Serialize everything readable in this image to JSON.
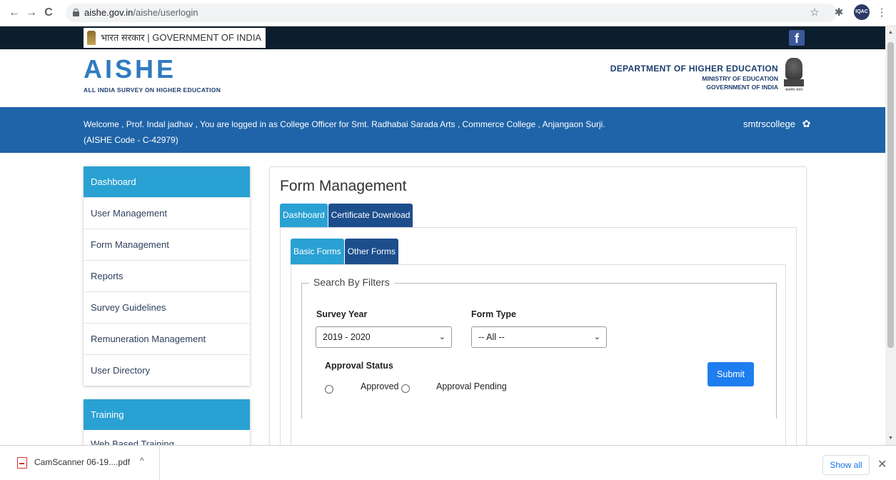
{
  "browser": {
    "url_host": "aishe.gov.in",
    "url_path": "/aishe/userlogin",
    "back_icon": "←",
    "forward_icon": "→",
    "reload_icon": "C",
    "star_icon": "☆",
    "puzzle_icon": "✱",
    "ext_badge": "IQAC",
    "menu_icon": "⋮"
  },
  "gov_strip": {
    "label": "भारत सरकार | GOVERNMENT OF INDIA",
    "facebook": "f"
  },
  "header": {
    "logo": "AISHE",
    "logo_sub": "ALL INDIA SURVEY ON HIGHER EDUCATION",
    "dept_line1": "DEPARTMENT OF HIGHER EDUCATION",
    "dept_line2": "MINISTRY OF EDUCATION",
    "dept_line3": "GOVERNMENT OF INDIA",
    "emblem_text": "सत्यमेव जयते"
  },
  "welcome": {
    "line1": "Welcome , Prof. Indal jadhav , You are logged in as College Officer for Smt. Radhabai Sarada Arts , Commerce College , Anjangaon Surji.",
    "line2": "(AISHE Code - C-42979)",
    "username": "smtrscollege",
    "gear": "✿"
  },
  "sidebar": {
    "heading": "Dashboard",
    "items": [
      {
        "label": "User Management"
      },
      {
        "label": "Form Management"
      },
      {
        "label": "Reports"
      },
      {
        "label": "Survey Guidelines"
      },
      {
        "label": "Remuneration Management"
      },
      {
        "label": "User Directory"
      }
    ]
  },
  "training": {
    "heading": "Training",
    "items": [
      {
        "label": "Web Based Training"
      }
    ]
  },
  "main": {
    "title": "Form Management",
    "tabs": [
      {
        "label": "Dashboard",
        "active": true
      },
      {
        "label": "Certificate Download",
        "active": false
      }
    ],
    "subtabs": [
      {
        "label": "Basic Forms",
        "active": true
      },
      {
        "label": "Other Forms",
        "active": false
      }
    ],
    "filters": {
      "legend": "Search By Filters",
      "survey_year_label": "Survey Year",
      "survey_year_value": "2019 - 2020",
      "form_type_label": "Form Type",
      "form_type_value": "-- All --",
      "approval_label": "Approval Status",
      "approved_label": "Approved",
      "pending_label": "Approval Pending",
      "submit_label": "Submit",
      "chevron": "⌄"
    }
  },
  "downloads": {
    "file_name": "CamScanner 06-19....pdf",
    "chevron": "^",
    "show_all": "Show all",
    "close": "✕"
  },
  "colors": {
    "welcome_bar": "#1f64a8",
    "sidebar_head": "#2aa1d3",
    "tab_inactive": "#1d4e8c",
    "submit": "#1e7ef0"
  }
}
